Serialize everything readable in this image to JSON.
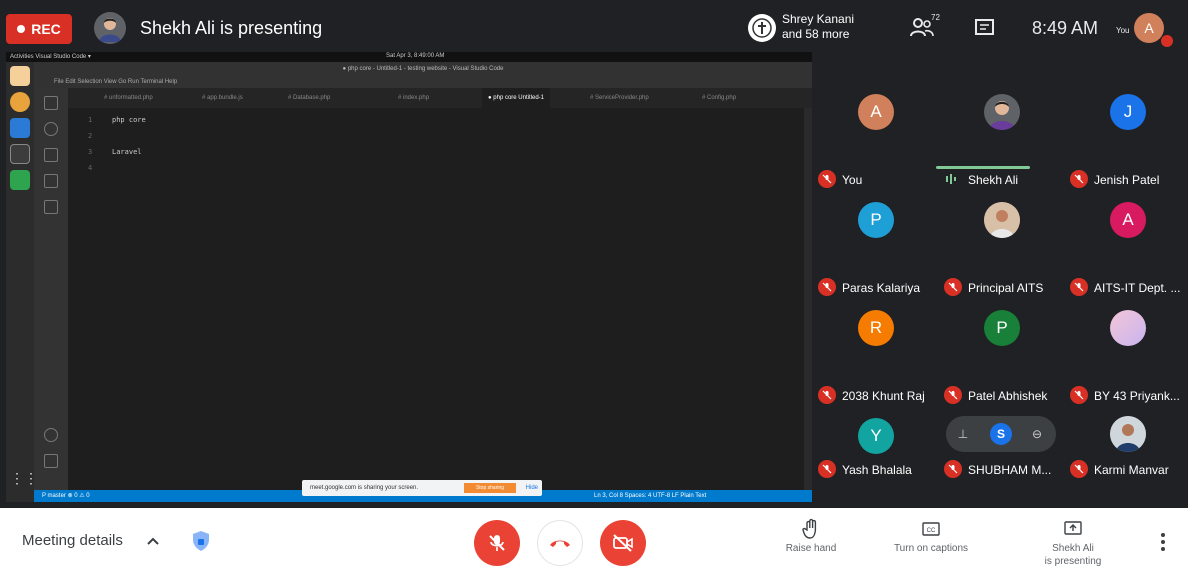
{
  "topbar": {
    "rec_label": "REC",
    "presenting_title": "Shekh Ali is presenting",
    "others_name": "Shrey Kanani",
    "others_more": "and 58 more",
    "people_count": "72",
    "time": "8:49 AM",
    "you_label": "You",
    "self_initial": "A"
  },
  "screen": {
    "topbar_left": "Activities   Visual Studio Code ▾",
    "topbar_center": "Sat Apr 3, 8:49:00 AM",
    "window_title": "● php core - Untitled-1 - testing website - Visual Studio Code",
    "menu": "File  Edit  Selection  View  Go  Run  Terminal  Help",
    "tabs": [
      {
        "label": "# unformatted.php"
      },
      {
        "label": "# app.bundle.js"
      },
      {
        "label": "# Database.php"
      },
      {
        "label": "# index.php"
      },
      {
        "label": "● php core Untitled-1",
        "active": true
      },
      {
        "label": "# ServiceProvider.php"
      },
      {
        "label": "# Config.php"
      }
    ],
    "code_lines": [
      {
        "num": "1",
        "text": "php core"
      },
      {
        "num": "2",
        "text": ""
      },
      {
        "num": "3",
        "text": "Laravel"
      },
      {
        "num": "4",
        "text": ""
      }
    ],
    "status_left": "P master  ⊗ 0 ⚠ 0",
    "status_right": "Ln 3, Col 8   Spaces: 4   UTF-8   LF   Plain Text",
    "notification": "meet.google.com is sharing your screen.",
    "notification_button": "Stop sharing",
    "notification_hide": "Hide"
  },
  "participants": [
    {
      "name": "You",
      "initial": "A",
      "color": "#d0805a",
      "muted": true
    },
    {
      "name": "Shekh Ali",
      "initial": "",
      "color": "#5f6368",
      "muted": false,
      "speaking": true
    },
    {
      "name": "Jenish Patel",
      "initial": "J",
      "color": "#1a73e8",
      "muted": true
    },
    {
      "name": "Paras Kalariya",
      "initial": "P",
      "color": "#1e9fd6",
      "muted": true
    },
    {
      "name": "Principal AITS",
      "initial": "",
      "color": "#8a6d5a",
      "muted": true
    },
    {
      "name": "AITS-IT Dept. ...",
      "initial": "A",
      "color": "#d81b60",
      "muted": true
    },
    {
      "name": "2038 Khunt Raj",
      "initial": "R",
      "color": "#f57c00",
      "muted": true
    },
    {
      "name": "Patel Abhishek",
      "initial": "P",
      "color": "#188038",
      "muted": true
    },
    {
      "name": "BY 43 Priyank...",
      "initial": "",
      "color": "#e7c6e8",
      "muted": true
    },
    {
      "name": "Yash Bhalala",
      "initial": "Y",
      "color": "#12a4a0",
      "muted": true
    },
    {
      "name": "SHUBHAM M...",
      "initial": "S",
      "color": "#1a73e8",
      "muted": true
    },
    {
      "name": "Karmi Manvar",
      "initial": "",
      "color": "#6d6d6d",
      "muted": true
    }
  ],
  "bottombar": {
    "meeting_details": "Meeting details",
    "raise_hand": "Raise hand",
    "captions": "Turn on captions",
    "presenting_line1": "Shekh Ali",
    "presenting_line2": "is presenting"
  },
  "colors": {
    "end_call": "#ea4335",
    "mute_red": "#d93025",
    "vscode_status": "#007acc",
    "speaking_green": "#81c995"
  }
}
